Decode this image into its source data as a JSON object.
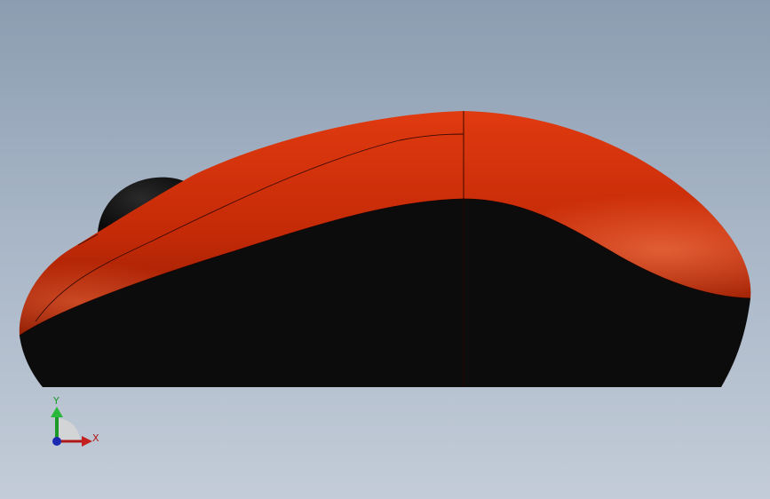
{
  "viewport": {
    "model_name": "computer-mouse",
    "colors": {
      "background_top": "#8c9db1",
      "background_bottom": "#c3ccd8",
      "shell_red": "#c32a08",
      "shell_red_dark": "#8a1a02",
      "base_black": "#0d0d0d",
      "wheel_black": "#0a0a0a"
    }
  },
  "triad": {
    "x_label": "X",
    "y_label": "Y",
    "colors": {
      "x_axis": "#b01818",
      "y_axis": "#1b9a2a",
      "z_axis": "#1b2ab0"
    }
  }
}
